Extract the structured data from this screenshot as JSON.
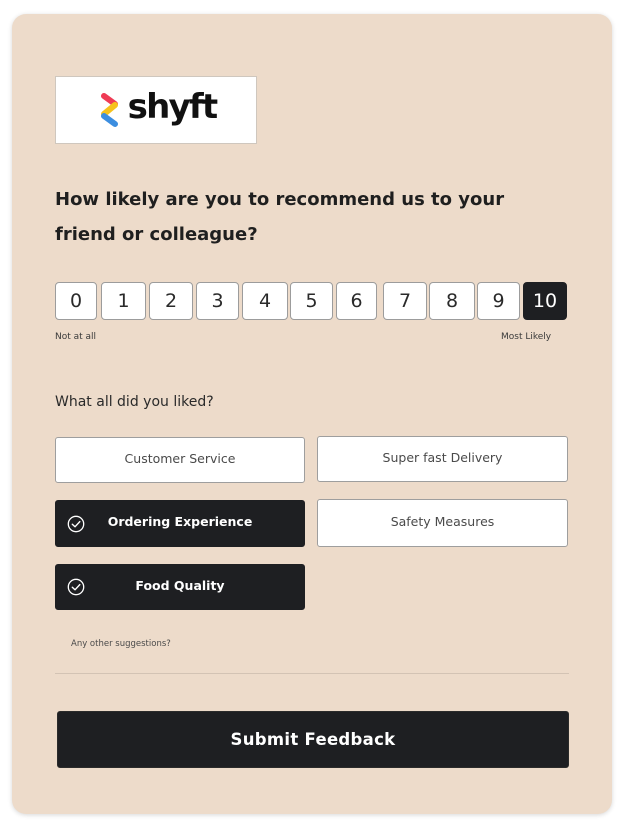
{
  "brand": {
    "name": "shyft",
    "colors": {
      "red": "#ef3b55",
      "yellow": "#f6c21c",
      "blue": "#3c8ee0"
    }
  },
  "question": "How likely are you to recommend us to your friend or colleague?",
  "scale": {
    "options": [
      "0",
      "1",
      "2",
      "3",
      "4",
      "5",
      "6",
      "7",
      "8",
      "9",
      "10"
    ],
    "selected": "10",
    "low_label": "Not at all",
    "high_label": "Most Likely"
  },
  "likes": {
    "title": "What all did you liked?",
    "options": [
      {
        "label": "Customer Service",
        "selected": false
      },
      {
        "label": "Super fast Delivery",
        "selected": false
      },
      {
        "label": "Ordering Experience",
        "selected": true
      },
      {
        "label": "Safety Measures",
        "selected": false
      },
      {
        "label": "Food Quality",
        "selected": true
      }
    ]
  },
  "suggestions": {
    "label": "Any other suggestions?",
    "value": ""
  },
  "submit_label": "Submit Feedback",
  "colors": {
    "card_bg": "#eddbca",
    "selected_bg": "#1e1f22"
  }
}
